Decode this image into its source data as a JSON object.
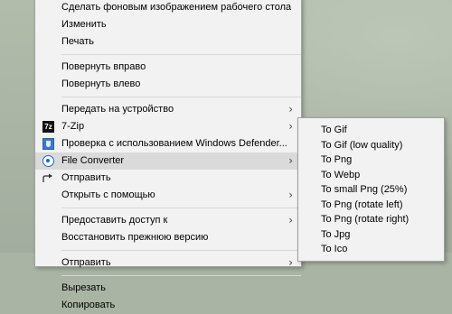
{
  "context_menu": {
    "items": [
      {
        "label": "Сделать фоновым изображением рабочего стола"
      },
      {
        "label": "Изменить"
      },
      {
        "label": "Печать"
      },
      {
        "label": "Повернуть вправо"
      },
      {
        "label": "Повернуть влево"
      },
      {
        "label": "Передать на устройство"
      },
      {
        "label": "7-Zip",
        "icon": "7zip-icon",
        "icon_text": "7z"
      },
      {
        "label": "Проверка с использованием Windows Defender...",
        "icon": "windows-defender-icon"
      },
      {
        "label": "File Converter",
        "icon": "file-converter-icon"
      },
      {
        "label": "Отправить",
        "icon": "share-icon"
      },
      {
        "label": "Открыть с помощью"
      },
      {
        "label": "Предоставить доступ к"
      },
      {
        "label": "Восстановить прежнюю версию"
      },
      {
        "label": "Отправить"
      },
      {
        "label": "Вырезать"
      },
      {
        "label": "Копировать"
      }
    ],
    "submenu_arrow": "›"
  },
  "file_converter_submenu": {
    "items": [
      {
        "label": "To Gif"
      },
      {
        "label": "To Gif (low quality)"
      },
      {
        "label": "To Png"
      },
      {
        "label": "To Webp"
      },
      {
        "label": "To small Png (25%)"
      },
      {
        "label": "To Png (rotate left)"
      },
      {
        "label": "To Png (rotate right)"
      },
      {
        "label": "To Jpg"
      },
      {
        "label": "To Ico"
      }
    ]
  },
  "colors": {
    "menu_background": "#f2f2f2",
    "highlight": "#dadada",
    "separator": "#d7d7d7",
    "desktop": "#a9b4a4",
    "converter_icon": "#1f63c7"
  }
}
